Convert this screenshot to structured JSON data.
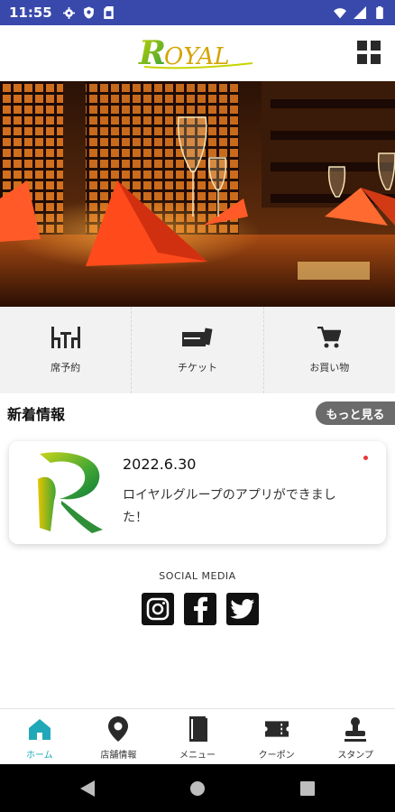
{
  "status_bar": {
    "time": "11:55",
    "left_icons": [
      "gear-icon",
      "shield-icon",
      "sim-card-icon"
    ],
    "right_icons": [
      "wifi-icon",
      "signal-icon",
      "battery-icon"
    ],
    "color": "#3949ab"
  },
  "header": {
    "logo_text": "ROYAL",
    "menu_icon": "grid-menu-icon"
  },
  "quick_actions": [
    {
      "label": "席予約",
      "icon": "table-reservation-icon"
    },
    {
      "label": "チケット",
      "icon": "ticket-icon"
    },
    {
      "label": "お買い物",
      "icon": "shopping-cart-icon"
    }
  ],
  "news": {
    "title": "新着情報",
    "more_label": "もっと見る",
    "items": [
      {
        "date": "2022.6.30",
        "text": "ロイヤルグループのアプリができました！",
        "unread": true
      }
    ]
  },
  "social": {
    "title": "SOCIAL MEDIA",
    "icons": [
      "instagram-icon",
      "facebook-icon",
      "twitter-icon"
    ]
  },
  "bottom_nav": {
    "active_color": "#20a8b8",
    "items": [
      {
        "label": "ホーム",
        "icon": "home-icon",
        "active": true
      },
      {
        "label": "店舗情報",
        "icon": "location-pin-icon",
        "active": false
      },
      {
        "label": "メニュー",
        "icon": "menu-book-icon",
        "active": false
      },
      {
        "label": "クーポン",
        "icon": "coupon-icon",
        "active": false
      },
      {
        "label": "スタンプ",
        "icon": "stamp-icon",
        "active": false
      }
    ]
  },
  "system_nav": [
    "back-icon",
    "home-circle-icon",
    "recents-icon"
  ]
}
